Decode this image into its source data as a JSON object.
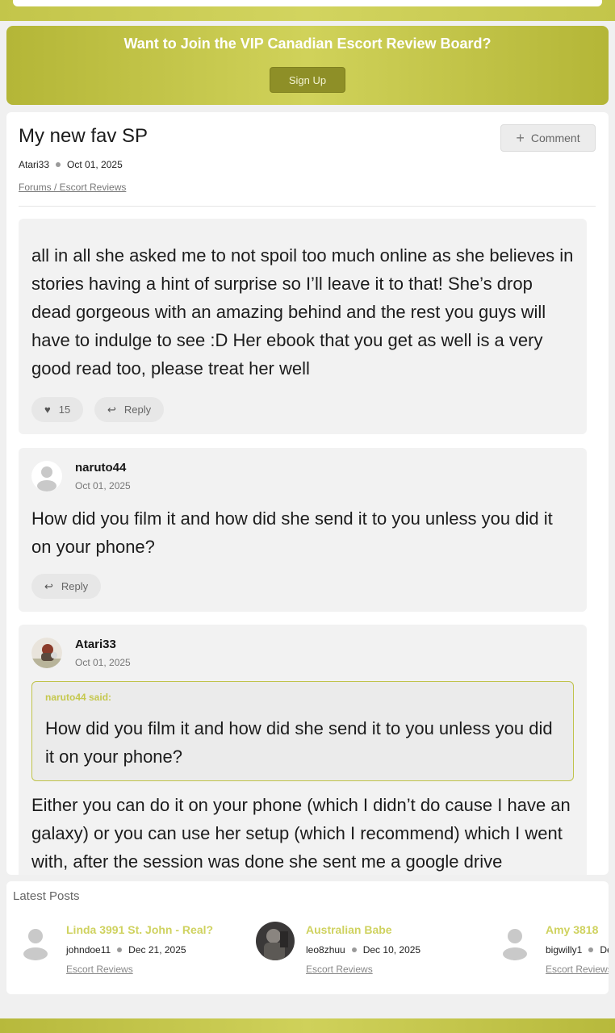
{
  "banner": {
    "title": "Want to Join the VIP Canadian Escort Review Board?",
    "signup_label": "Sign Up"
  },
  "thread": {
    "title": "My new fav SP",
    "comment_label": "Comment",
    "author": "Atari33",
    "date": "Oct 01, 2025",
    "breadcrumb": "Forums / Escort Reviews"
  },
  "posts": [
    {
      "text": "all in all she asked me to not spoil too much online as she believes in stories having a hint of surprise so I’ll leave it to that! She’s drop dead gorgeous with an amazing behind and the rest you guys will have to indulge to see :D Her ebook that you get as well is a very good read too, please treat her well",
      "likes": "15",
      "reply_label": "Reply"
    },
    {
      "author": "naruto44",
      "date": "Oct 01, 2025",
      "text": "How did you film it and how did she send it to you unless you did it on your phone?",
      "reply_label": "Reply"
    },
    {
      "author": "Atari33",
      "date": "Oct 01, 2025",
      "quote_author": "naruto44 said:",
      "quote_text": "How did you film it and how did she send it to you unless you did it on your phone?",
      "text": "Either you can do it on your phone (which I didn’t do cause I have an galaxy) or you can use her setup (which I recommend) which I went with, after the session was done she sent me a google drive"
    }
  ],
  "latest": {
    "heading": "Latest Posts",
    "items": [
      {
        "title": "Linda 3991 St. John - Real?",
        "author": "johndoe11",
        "date": "Dec 21, 2025",
        "category": "Escort Reviews"
      },
      {
        "title": "Australian Babe",
        "author": "leo8zhuu",
        "date": "Dec 10, 2025",
        "category": "Escort Reviews"
      },
      {
        "title": "Amy 3818",
        "author": "bigwilly1",
        "date": "Dec",
        "category": "Escort Reviews"
      }
    ]
  },
  "colors": {
    "brand": "#c6c94f",
    "button": "#8e8f27",
    "link_title": "#cfd25f"
  },
  "icons": {
    "like": "heart-icon",
    "reply": "reply-arrow-icon",
    "comment": "plus-icon",
    "avatar_default": "default-user-icon"
  }
}
